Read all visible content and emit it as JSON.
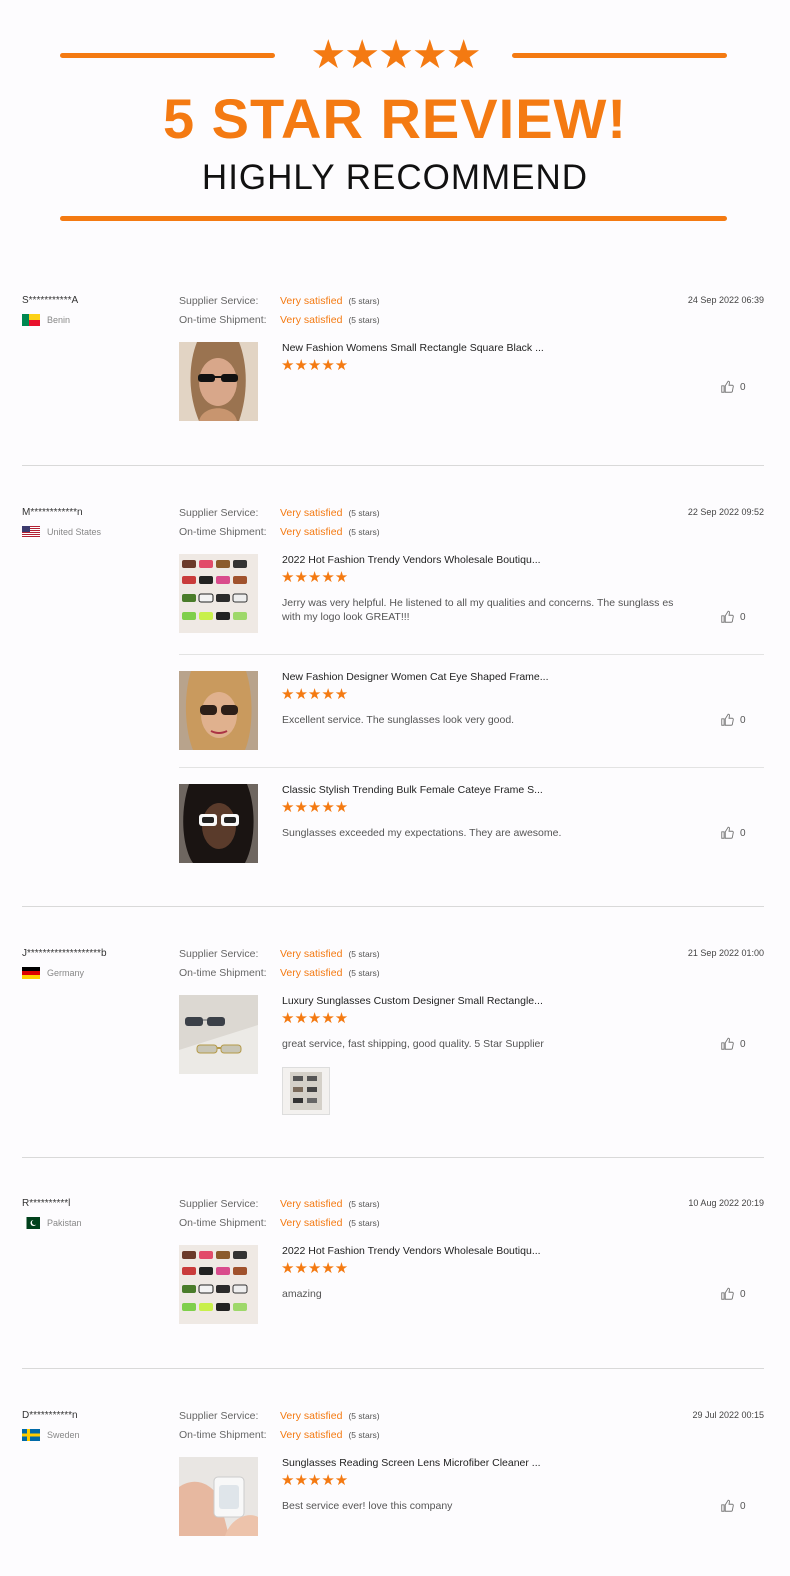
{
  "banner": {
    "stars": "★★★★★",
    "headline": "5 STAR REVIEW!",
    "subline": "HIGHLY RECOMMEND"
  },
  "labels": {
    "supplier_service": "Supplier Service:",
    "ontime_shipment": "On-time Shipment:"
  },
  "colors": {
    "accent": "#f47a12"
  },
  "reviews": [
    {
      "buyer": "S***********A",
      "country": "Benin",
      "flag": "benin",
      "date": "24 Sep 2022 06:39",
      "supplier_value": "Very satisfied",
      "supplier_count": "(5 stars)",
      "shipment_value": "Very satisfied",
      "shipment_count": "(5 stars)",
      "items": [
        {
          "title": "New Fashion Womens Small Rectangle Square Black ...",
          "stars": "★★★★★",
          "rating": 5,
          "comment": "",
          "likes": "0",
          "thumb_icon": "woman-sunglasses-photo"
        }
      ]
    },
    {
      "buyer": "M************n",
      "country": "United States",
      "flag": "usa",
      "date": "22 Sep 2022 09:52",
      "supplier_value": "Very satisfied",
      "supplier_count": "(5 stars)",
      "shipment_value": "Very satisfied",
      "shipment_count": "(5 stars)",
      "items": [
        {
          "title": "2022 Hot Fashion Trendy Vendors Wholesale Boutiqu...",
          "stars": "★★★★★",
          "rating": 5,
          "comment": "Jerry was very helpful. He listened to all my qualities and concerns. The sunglass es with my logo look GREAT!!!",
          "likes": "0"
        },
        {
          "title": "New Fashion Designer Women Cat Eye Shaped Frame...",
          "stars": "★★★★★",
          "rating": 5,
          "comment": "Excellent service.  The sunglasses look very good.",
          "likes": "0"
        },
        {
          "title": "Classic Stylish Trending Bulk Female Cateye Frame S...",
          "stars": "★★★★★",
          "rating": 5,
          "comment": "Sunglasses exceeded my expectations. They are awesome.",
          "likes": "0"
        }
      ]
    },
    {
      "buyer": "J*******************b",
      "country": "Germany",
      "flag": "germany",
      "date": "21 Sep 2022 01:00",
      "supplier_value": "Very satisfied",
      "supplier_count": "(5 stars)",
      "shipment_value": "Very satisfied",
      "shipment_count": "(5 stars)",
      "items": [
        {
          "title": "Luxury Sunglasses Custom Designer Small Rectangle...",
          "stars": "★★★★★",
          "rating": 5,
          "comment": "great service, fast shipping, good quality. 5 Star Supplier",
          "likes": "0"
        }
      ]
    },
    {
      "buyer": "R**********l",
      "country": "Pakistan",
      "flag": "pakistan",
      "date": "10 Aug 2022 20:19",
      "supplier_value": "Very satisfied",
      "supplier_count": "(5 stars)",
      "shipment_value": "Very satisfied",
      "shipment_count": "(5 stars)",
      "items": [
        {
          "title": "2022 Hot Fashion Trendy Vendors Wholesale Boutiqu...",
          "stars": "★★★★★",
          "rating": 5,
          "comment": "amazing",
          "likes": "0"
        }
      ]
    },
    {
      "buyer": "D***********n",
      "country": "Sweden",
      "flag": "sweden",
      "date": "29 Jul 2022 00:15",
      "supplier_value": "Very satisfied",
      "supplier_count": "(5 stars)",
      "shipment_value": "Very satisfied",
      "shipment_count": "(5 stars)",
      "items": [
        {
          "title": "Sunglasses Reading Screen Lens Microfiber Cleaner ...",
          "stars": "★★★★★",
          "rating": 5,
          "comment": "Best service ever! love this company",
          "likes": "0"
        }
      ]
    }
  ]
}
